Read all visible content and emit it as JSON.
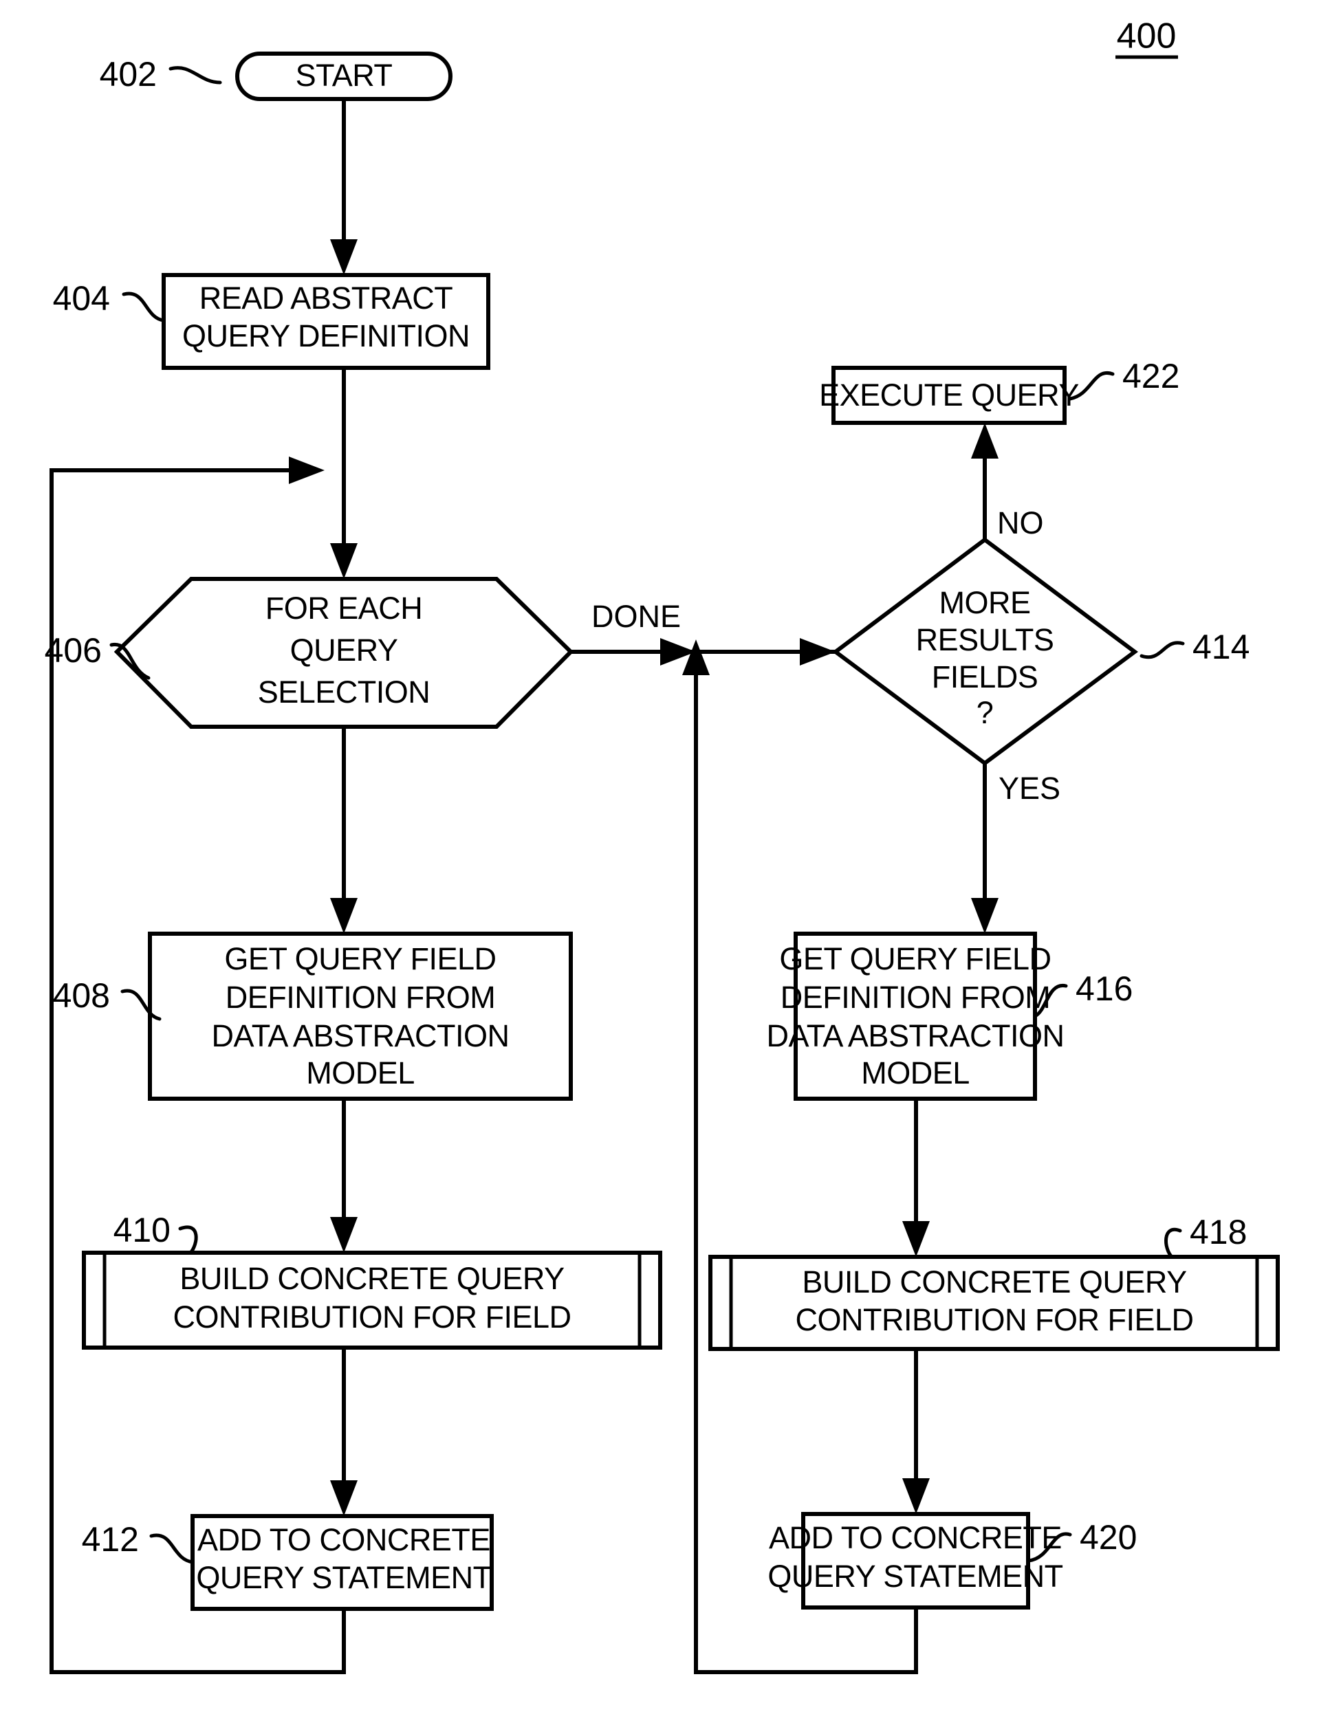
{
  "figure": {
    "number": "400"
  },
  "nodes": [
    {
      "id": "402",
      "ref": "402",
      "shape": "terminator",
      "lines": [
        "START"
      ]
    },
    {
      "id": "404",
      "ref": "404",
      "shape": "process",
      "lines": [
        "READ ABSTRACT",
        "QUERY DEFINITION"
      ]
    },
    {
      "id": "406",
      "ref": "406",
      "shape": "loop-hexagon",
      "lines": [
        "FOR EACH",
        "QUERY",
        "SELECTION"
      ]
    },
    {
      "id": "408",
      "ref": "408",
      "shape": "process",
      "lines": [
        "GET QUERY FIELD",
        "DEFINITION FROM",
        "DATA ABSTRACTION",
        "MODEL"
      ]
    },
    {
      "id": "410",
      "ref": "410",
      "shape": "predefined-process",
      "lines": [
        "BUILD  CONCRETE QUERY",
        "CONTRIBUTION FOR FIELD"
      ]
    },
    {
      "id": "412",
      "ref": "412",
      "shape": "process",
      "lines": [
        "ADD TO CONCRETE",
        "QUERY STATEMENT"
      ]
    },
    {
      "id": "414",
      "ref": "414",
      "shape": "decision",
      "lines": [
        "MORE",
        "RESULTS",
        "FIELDS",
        "?"
      ]
    },
    {
      "id": "416",
      "ref": "416",
      "shape": "process",
      "lines": [
        "GET QUERY FIELD",
        "DEFINITION FROM",
        "DATA ABSTRACTION",
        "MODEL"
      ]
    },
    {
      "id": "418",
      "ref": "418",
      "shape": "predefined-process",
      "lines": [
        "BUILD  CONCRETE QUERY",
        "CONTRIBUTION FOR FIELD"
      ]
    },
    {
      "id": "420",
      "ref": "420",
      "shape": "process",
      "lines": [
        "ADD TO CONCRETE",
        "QUERY STATEMENT"
      ]
    },
    {
      "id": "422",
      "ref": "422",
      "shape": "process",
      "lines": [
        "EXECUTE QUERY"
      ]
    }
  ],
  "edge_labels": {
    "done": "DONE",
    "no": "NO",
    "yes": "YES"
  },
  "text": {
    "start": "START",
    "read_abstract_1": "READ ABSTRACT",
    "read_abstract_2": "QUERY DEFINITION",
    "for_each_1": "FOR EACH",
    "for_each_2": "QUERY",
    "for_each_3": "SELECTION",
    "get_field_1": "GET QUERY FIELD",
    "get_field_2": "DEFINITION FROM",
    "get_field_3": "DATA ABSTRACTION",
    "get_field_4": "MODEL",
    "build_1": "BUILD  CONCRETE QUERY",
    "build_2": "CONTRIBUTION FOR FIELD",
    "add_1": "ADD TO CONCRETE",
    "add_2": "QUERY STATEMENT",
    "more_1": "MORE",
    "more_2": "RESULTS",
    "more_3": "FIELDS",
    "more_4": "?",
    "execute": "EXECUTE QUERY",
    "ref_402": "402",
    "ref_404": "404",
    "ref_406": "406",
    "ref_408": "408",
    "ref_410": "410",
    "ref_412": "412",
    "ref_414": "414",
    "ref_416": "416",
    "ref_418": "418",
    "ref_420": "420",
    "ref_422": "422",
    "fig_400": "400",
    "done": "DONE",
    "no": "NO",
    "yes": "YES"
  },
  "colors": {
    "ink": "#000000",
    "paper": "#ffffff"
  }
}
